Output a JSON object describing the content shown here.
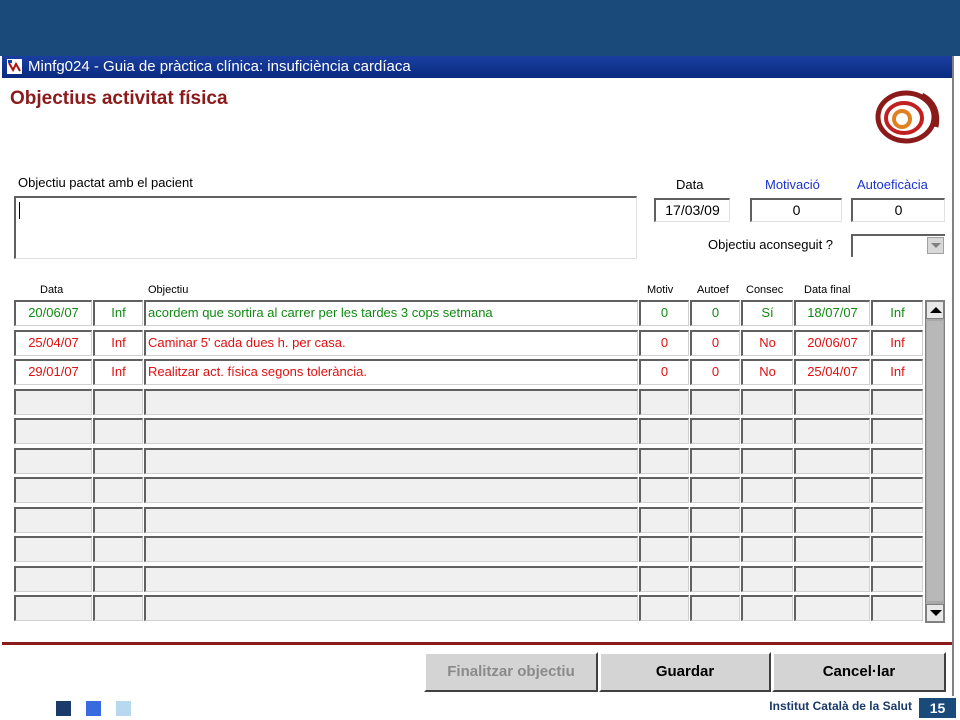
{
  "window": {
    "title": "Minfg024 - Guia de pràctica clínica: insuficiència cardíaca"
  },
  "form": {
    "title": "Objectius activitat física",
    "goal_label": "Objectiu pactat amb el pacient",
    "goal_value": "",
    "date_label": "Data",
    "date_value": "17/03/09",
    "motivation_label": "Motivació",
    "motivation_value": "0",
    "selfefficacy_label": "Autoeficàcia",
    "selfefficacy_value": "0",
    "achieved_label": "Objectiu aconseguit ?",
    "achieved_value": ""
  },
  "table": {
    "headers": [
      "Data",
      "Objectiu",
      "Motiv",
      "Autoef",
      "Consec",
      "Data final"
    ],
    "rows": [
      {
        "date": "20/06/07",
        "inf": "Inf",
        "objective": "acordem que sortira al carrer per les tardes 3 cops setmana",
        "motiv": "0",
        "autoef": "0",
        "consec": "Sí",
        "date_final": "18/07/07",
        "inf2": "Inf",
        "status": "green"
      },
      {
        "date": "25/04/07",
        "inf": "Inf",
        "objective": "Caminar 5' cada dues h. per casa.",
        "motiv": "0",
        "autoef": "0",
        "consec": "No",
        "date_final": "20/06/07",
        "inf2": "Inf",
        "status": "red"
      },
      {
        "date": "29/01/07",
        "inf": "Inf",
        "objective": "Realitzar act. física segons tolerància.",
        "motiv": "0",
        "autoef": "0",
        "consec": "No",
        "date_final": "25/04/07",
        "inf2": "Inf",
        "status": "red"
      }
    ],
    "empty_rows": 8
  },
  "buttons": {
    "finish": "Finalitzar objectiu",
    "save": "Guardar",
    "cancel": "Cancel·lar"
  },
  "footer": {
    "institute": "Institut Català de la Salut",
    "page": "15"
  },
  "colors": {
    "title_red": "#8b1a1a",
    "header_blue": "#1a4a7a",
    "green_row": "#128a12",
    "red_row": "#e01010",
    "label_blue": "#1a33cc"
  }
}
